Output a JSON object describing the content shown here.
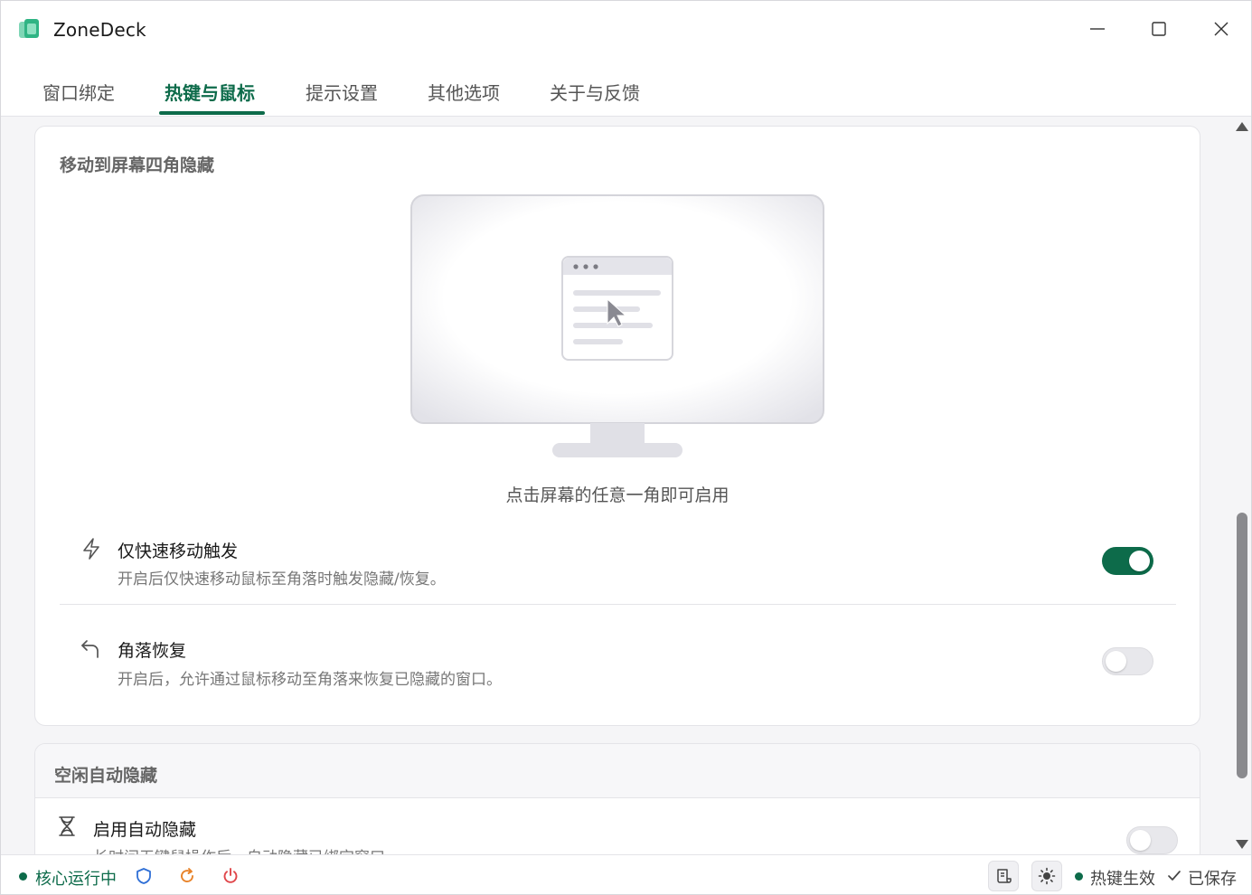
{
  "window": {
    "title": "ZoneDeck"
  },
  "tabs": [
    {
      "label": "窗口绑定",
      "active": false
    },
    {
      "label": "热键与鼠标",
      "active": true
    },
    {
      "label": "提示设置",
      "active": false
    },
    {
      "label": "其他选项",
      "active": false
    },
    {
      "label": "关于与反馈",
      "active": false
    }
  ],
  "corner_hide": {
    "title": "移动到屏幕四角隐藏",
    "caption": "点击屏幕的任意一角即可启用",
    "options": [
      {
        "icon": "lightning-icon",
        "title": "仅快速移动触发",
        "desc": "开启后仅快速移动鼠标至角落时触发隐藏/恢复。",
        "enabled": true
      },
      {
        "icon": "undo-arrow-icon",
        "title": "角落恢复",
        "desc": "开启后，允许通过鼠标移动至角落来恢复已隐藏的窗口。",
        "enabled": false
      }
    ]
  },
  "idle_hide": {
    "title": "空闲自动隐藏",
    "option": {
      "icon": "hourglass-icon",
      "title": "启用自动隐藏",
      "desc": "长时间无键鼠操作后，自动隐藏已绑定窗口",
      "enabled": false
    }
  },
  "statusbar": {
    "core_status": "核心运行中",
    "hotkey_status": "热键生效",
    "save_status": "已保存"
  },
  "colors": {
    "accent": "#0d6b4a",
    "power": "#e0464a",
    "refresh": "#e8832a",
    "shield": "#2f6fd6"
  }
}
